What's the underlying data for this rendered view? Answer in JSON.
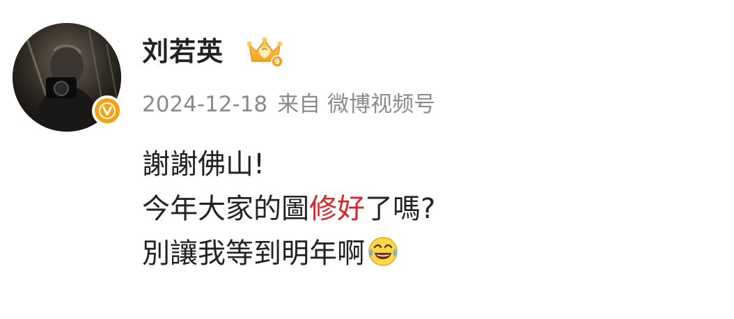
{
  "post": {
    "username": "刘若英",
    "date": "2024-12-18",
    "source_prefix": "来自",
    "source_name": "微博视频号",
    "badge_number": "9",
    "content": {
      "line1": "謝謝佛山!",
      "line2_before": "今年大家的圖",
      "line2_highlight": "修好",
      "line2_after": "了嗎?",
      "line3": "別讓我等到明年啊"
    }
  },
  "icons": {
    "verified": "verified-v-icon",
    "crown": "crown-level-icon",
    "emoji": "laugh-cry-emoji-icon"
  },
  "colors": {
    "highlight": "#d7262a",
    "verified_badge": "#f5a312",
    "meta_text": "#8a8a8a",
    "body_text": "#222222"
  }
}
